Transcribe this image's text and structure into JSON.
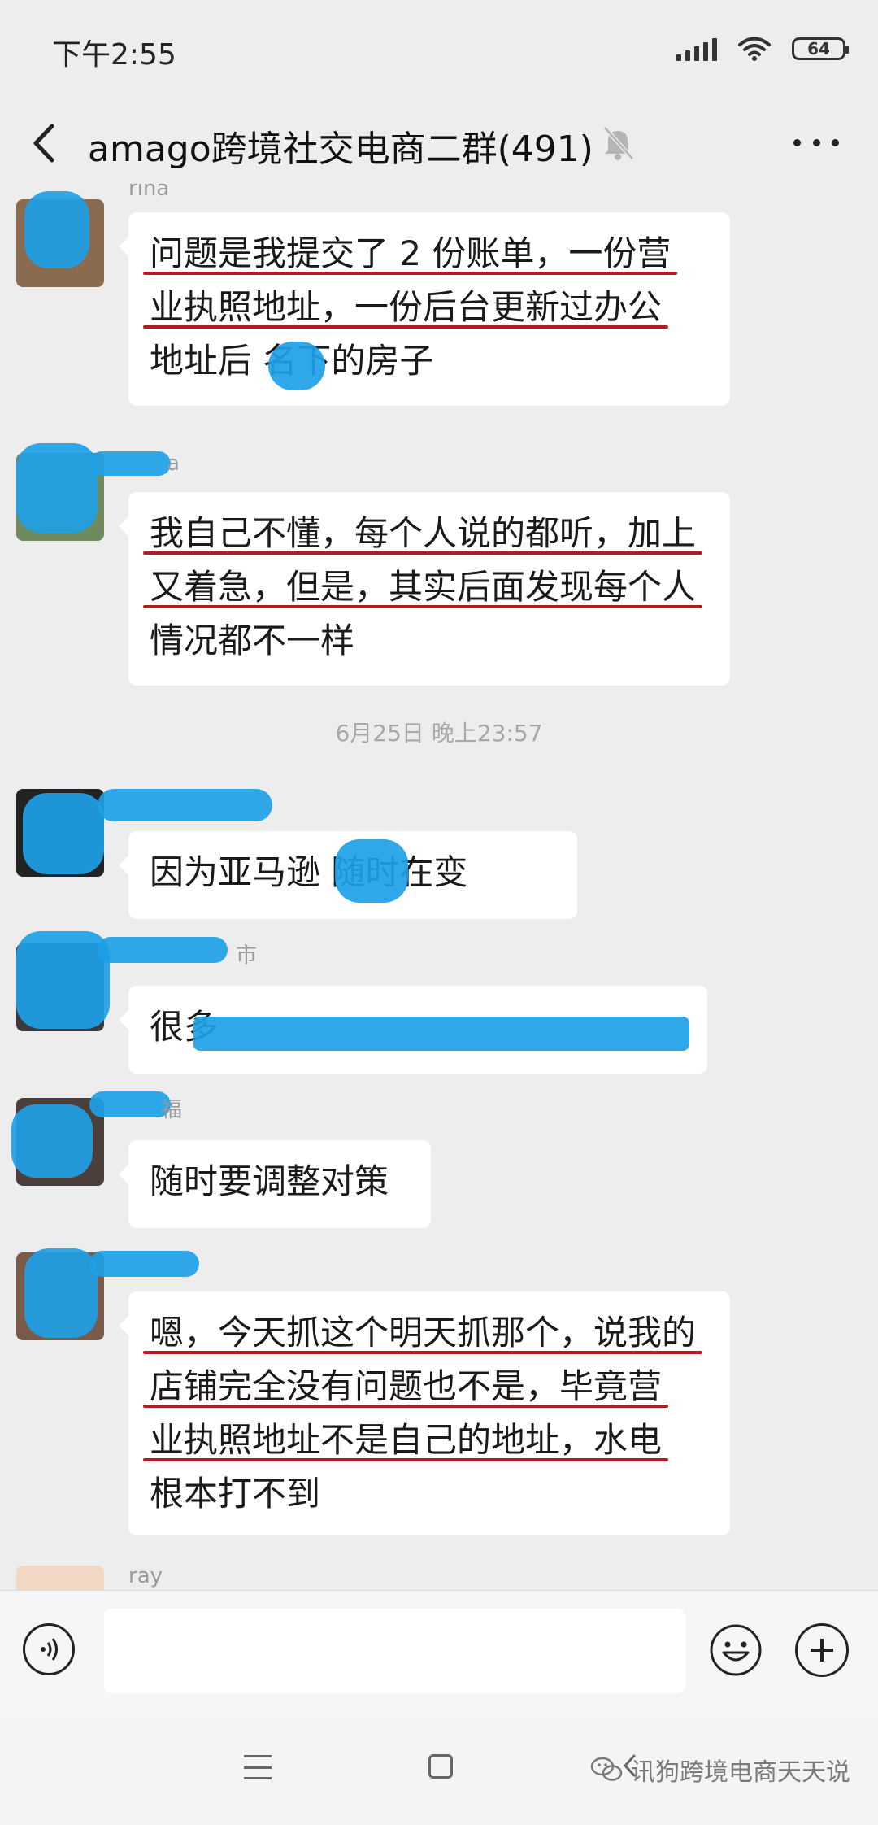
{
  "status_bar": {
    "time": "下午2:55",
    "battery": "64"
  },
  "header": {
    "title": "amago跨境社交电商二群(491)"
  },
  "messages": [
    {
      "sender": "rina",
      "lines": [
        "问题是我提交了 2 份账单，一份营",
        "业执照地址，一份后台更新过办公",
        "地址后 名下的房子"
      ]
    },
    {
      "sender": "a",
      "lines": [
        "我自己不懂，每个人说的都听，加上",
        "又着急，但是，其实后面发现每个人",
        "情况都不一样"
      ]
    },
    {
      "sender": "",
      "lines": [
        "因为亚马逊 随时在变"
      ]
    },
    {
      "sender": "市",
      "lines": [
        "很多"
      ]
    },
    {
      "sender": "福",
      "lines": [
        "随时要调整对策"
      ]
    },
    {
      "sender": "",
      "lines": [
        "嗯，今天抓这个明天抓那个，说我的",
        "店铺完全没有问题也不是，毕竟营",
        "业执照地址不是自己的地址，水电",
        "根本打不到"
      ]
    },
    {
      "sender": "ray",
      "lines": []
    }
  ],
  "timestamp": "6月25日 晚上23:57",
  "watermark": "讯狗跨境电商天天说",
  "icons": {
    "back": "chevron-left-icon",
    "mute": "bell-mute-icon",
    "more": "more-dots-icon",
    "voice": "voice-icon",
    "emoji": "emoji-icon",
    "plus": "plus-icon"
  },
  "colors": {
    "underline": "#b31b22",
    "redaction": "#1ea0e6",
    "background": "#ededed"
  }
}
